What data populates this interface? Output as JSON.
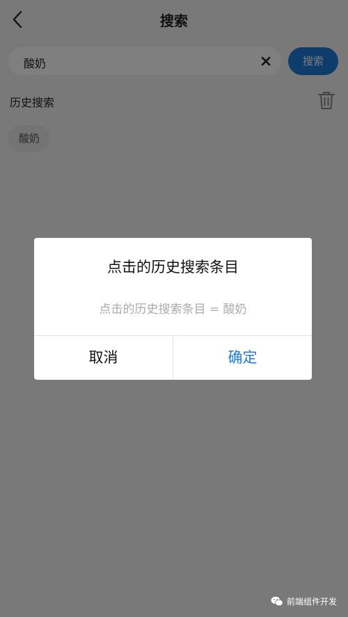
{
  "navbar": {
    "title": "搜索",
    "back_icon": "chevron-left-icon"
  },
  "search": {
    "query": "酸奶",
    "clear_icon": "close-icon",
    "button_label": "搜索",
    "accent_color": "#1e7ad6"
  },
  "history": {
    "title": "历史搜索",
    "delete_icon": "trash-icon",
    "items": [
      "酸奶"
    ]
  },
  "dialog": {
    "title": "点击的历史搜索条目",
    "message": "点击的历史搜索条目 = 酸奶",
    "cancel_label": "取消",
    "confirm_label": "确定"
  },
  "watermark": {
    "icon": "wechat-icon",
    "text": "前端组件开发"
  }
}
